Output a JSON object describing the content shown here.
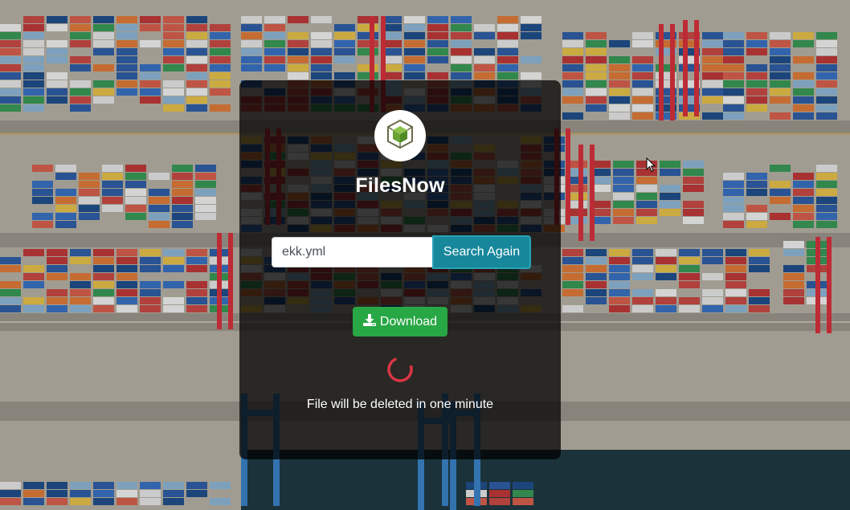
{
  "app": {
    "name": "FilesNow",
    "logo_icon": "cube-icon",
    "accent": "#6ab04c"
  },
  "search": {
    "value": "ekk.yml",
    "button_label": "Search Again",
    "button_color": "#17879c"
  },
  "download": {
    "label": "Download",
    "icon": "download-icon",
    "color": "#28a745"
  },
  "status": {
    "spinner_color": "#dc3545",
    "notice": "File will be deleted in one minute"
  },
  "background": {
    "description_icon": "shipping-containers-background"
  }
}
